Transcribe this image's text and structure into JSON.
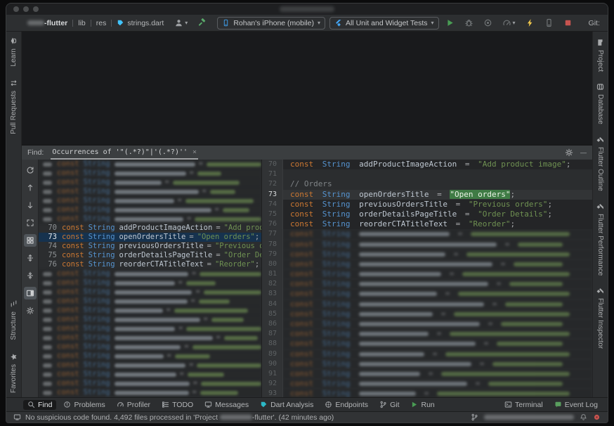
{
  "titlebar": {
    "title_redacted": true
  },
  "toolbar": {
    "project_suffix": "-flutter",
    "crumbs": [
      "lib",
      "res"
    ],
    "file": "strings.dart",
    "file_icon": "dartlogo",
    "device_selector": "Rohan's iPhone (mobile)",
    "run_config": "All Unit and Widget Tests",
    "git_label": "Git:",
    "user_controls": [
      {
        "name": "user-profile-button",
        "icon": "person",
        "color": "#9da0a3",
        "chevron": true
      },
      {
        "name": "build-button",
        "icon": "hammer",
        "color": "#59a869"
      }
    ],
    "run_controls": [
      {
        "name": "run-button",
        "icon": "play",
        "color": "#499c54"
      },
      {
        "name": "debug-button",
        "icon": "bug",
        "color": "#6f7375"
      },
      {
        "name": "coverage-button",
        "icon": "coverage",
        "color": "#6f7375"
      },
      {
        "name": "profile-button",
        "icon": "gauge",
        "color": "#6f7375",
        "chevron": true
      },
      {
        "name": "hot-reload-button",
        "icon": "bolt",
        "color": "#f2c94c"
      },
      {
        "name": "attach-device-button",
        "icon": "phone",
        "color": "#6f7375"
      },
      {
        "name": "stop-button",
        "icon": "stop",
        "color": "#c75450"
      }
    ],
    "git_controls": [
      {
        "name": "update-project-button",
        "icon": "arrow-dl",
        "color": "#3d94d9"
      },
      {
        "name": "commit-button",
        "icon": "check",
        "color": "#59a869"
      },
      {
        "name": "push-button",
        "icon": "arrow-ur",
        "color": "#59a869"
      },
      {
        "name": "history-button",
        "icon": "clock",
        "color": "#9da0a3"
      },
      {
        "name": "rollback-button",
        "icon": "rollback",
        "color": "#6f7375"
      }
    ],
    "right_controls": [
      {
        "name": "search-everywhere-button",
        "icon": "search",
        "color": "#afb1b3"
      },
      {
        "name": "settings-button",
        "icon": "gear",
        "color": "#afb1b3"
      },
      {
        "name": "flutter-daemon-icon",
        "icon": "flutter-color",
        "color": "#45d1fd"
      }
    ]
  },
  "stripes": {
    "left_top": [
      {
        "label": "Learn",
        "icon": "learn"
      },
      {
        "label": "Pull Requests",
        "icon": "pr"
      }
    ],
    "left_bottom": [
      {
        "label": "Structure",
        "icon": "structure"
      },
      {
        "label": "Favorites",
        "icon": "star"
      }
    ],
    "right": [
      {
        "label": "Project",
        "icon": "folder"
      },
      {
        "label": "Database",
        "icon": "db"
      },
      {
        "label": "Flutter Outline",
        "icon": "flutter"
      },
      {
        "label": "Flutter Performance",
        "icon": "flutter"
      },
      {
        "label": "Flutter Inspector",
        "icon": "flutter"
      }
    ]
  },
  "find": {
    "label": "Find:",
    "tab_title": "Occurrences of '\"(.*?)\"|'(.*?)''",
    "tab_close": "×",
    "header_minimize": "—",
    "toolbar": [
      {
        "name": "rerun-find-button",
        "icon": "rerun"
      },
      {
        "name": "previous-occurrence-button",
        "icon": "arrow-up"
      },
      {
        "name": "next-occurrence-button",
        "icon": "arrow-down"
      },
      {
        "name": "navigate-source-button",
        "icon": "locate"
      },
      {
        "name": "group-by-button",
        "icon": "groupby",
        "selected": true
      },
      {
        "name": "expand-all-button",
        "icon": "expandall"
      },
      {
        "name": "collapse-all-button",
        "icon": "collapseall"
      },
      {
        "name": "preview-toggle-button",
        "icon": "previewtoggle",
        "selected": true
      },
      {
        "name": "find-settings-button",
        "icon": "gear"
      }
    ],
    "keyword": "const",
    "type": "String",
    "results": {
      "redacted_above": 7,
      "rows": [
        {
          "num": "70",
          "name": "addProductImageAction",
          "value": "\"Add product image\""
        },
        {
          "num": "73",
          "name": "openOrdersTitle",
          "value": "\"Open orders\"",
          "selected": true
        },
        {
          "num": "74",
          "name": "previousOrdersTitle",
          "value": "\"Previous orders\""
        },
        {
          "num": "75",
          "name": "orderDetailsPageTitle",
          "value": "\"Order Details\""
        },
        {
          "num": "76",
          "name": "reorderCTATitleText",
          "value": "\"Reorder\""
        }
      ],
      "redacted_below": 14
    },
    "preview_lines": [
      {
        "num": "70",
        "kind": "code",
        "name": "addProductImageAction",
        "value": "\"Add product image\""
      },
      {
        "num": "71",
        "kind": "blank"
      },
      {
        "num": "72",
        "kind": "comment",
        "text": "// Orders"
      },
      {
        "num": "73",
        "kind": "code",
        "name": "openOrdersTitle",
        "value": "\"Open orders\"",
        "highlight": true,
        "current": true
      },
      {
        "num": "74",
        "kind": "code",
        "name": "previousOrdersTitle",
        "value": "\"Previous orders\""
      },
      {
        "num": "75",
        "kind": "code",
        "name": "orderDetailsPageTitle",
        "value": "\"Order Details\""
      },
      {
        "num": "76",
        "kind": "code",
        "name": "reorderCTATitleText",
        "value": "\"Reorder\""
      },
      {
        "num": "77",
        "kind": "redacted"
      },
      {
        "num": "78",
        "kind": "redacted"
      },
      {
        "num": "79",
        "kind": "redacted"
      },
      {
        "num": "80",
        "kind": "redacted"
      },
      {
        "num": "81",
        "kind": "redacted"
      },
      {
        "num": "82",
        "kind": "redacted"
      },
      {
        "num": "83",
        "kind": "redacted"
      },
      {
        "num": "84",
        "kind": "redacted"
      },
      {
        "num": "85",
        "kind": "redacted"
      },
      {
        "num": "86",
        "kind": "redacted"
      },
      {
        "num": "87",
        "kind": "redacted"
      },
      {
        "num": "88",
        "kind": "redacted"
      },
      {
        "num": "89",
        "kind": "redacted"
      },
      {
        "num": "90",
        "kind": "redacted"
      },
      {
        "num": "91",
        "kind": "redacted"
      },
      {
        "num": "92",
        "kind": "redacted"
      },
      {
        "num": "93",
        "kind": "redacted"
      }
    ]
  },
  "bottom_bar": {
    "left": [
      {
        "label": "Find",
        "icon": "search",
        "selected": true
      },
      {
        "label": "Problems",
        "icon": "problems"
      },
      {
        "label": "Profiler",
        "icon": "gauge"
      },
      {
        "label": "TODO",
        "icon": "todo"
      },
      {
        "label": "Messages",
        "icon": "messages"
      },
      {
        "label": "Dart Analysis",
        "icon": "dartlogo",
        "color": "#2cb8c6"
      },
      {
        "label": "Endpoints",
        "icon": "endpoints"
      },
      {
        "label": "Git",
        "icon": "branch"
      },
      {
        "label": "Run",
        "icon": "play",
        "color": "#499c54"
      }
    ],
    "right": [
      {
        "label": "Terminal",
        "icon": "terminal"
      },
      {
        "label": "Event Log",
        "icon": "eventlog",
        "color": "#599e5e"
      }
    ]
  },
  "status_bar": {
    "message_prefix": "No suspicious code found. 4,492 files processed in 'Project ",
    "message_suffix": "-flutter'. (42 minutes ago)",
    "branch_redacted": true
  },
  "colors": {
    "selection_blue": "#16324e",
    "occurrence_green": "#3f7b45",
    "keyword_orange": "#cc7832",
    "type_blue": "#5593cf",
    "string_green": "#6f9152",
    "accent_run_green": "#499c54",
    "stop_red": "#c75450",
    "hot_reload_yellow": "#f2c94c"
  }
}
